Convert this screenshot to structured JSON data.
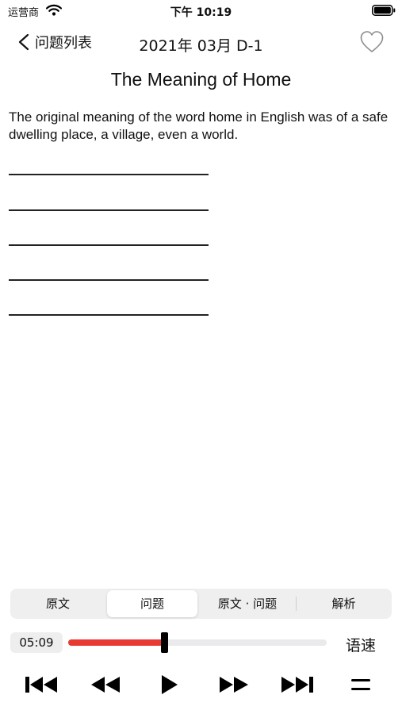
{
  "status_bar": {
    "carrier": "运营商",
    "time": "下午 10:19"
  },
  "nav": {
    "back_label": "问题列表",
    "title": "2021年 03月 D-1"
  },
  "article": {
    "title": "The Meaning of Home",
    "passage": "The original meaning of the word home in English was of a safe dwelling place, a village, even a world."
  },
  "answer_lines": 5,
  "tabs": [
    {
      "label": "原文",
      "active": false
    },
    {
      "label": "问题",
      "active": true
    },
    {
      "label": "原文 · 问题",
      "active": false
    },
    {
      "label": "解析",
      "active": false
    }
  ],
  "player": {
    "elapsed": "05:09",
    "progress": 0.37,
    "speed_label": "语速"
  },
  "controls": [
    "skip-to-start-icon",
    "rewind-icon",
    "play-icon",
    "fast-forward-icon",
    "skip-to-end-icon",
    "menu-icon"
  ],
  "colors": {
    "progress": "#e83a32",
    "segment_bg": "#efeff0"
  }
}
